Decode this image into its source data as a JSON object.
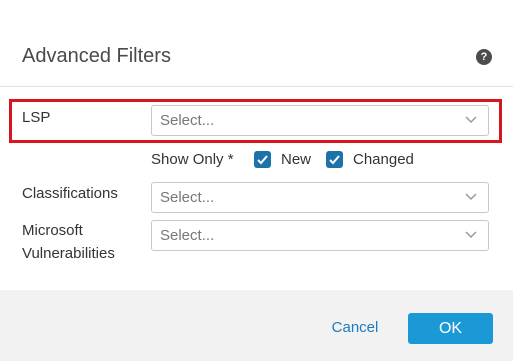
{
  "dialog": {
    "title": "Advanced Filters",
    "help_icon": "question-circle-icon",
    "help_glyph": "?"
  },
  "fields": {
    "lsp": {
      "label": "LSP",
      "placeholder": "Select..."
    },
    "show_only": {
      "label": "Show Only *",
      "options": [
        {
          "label": "New",
          "checked": true
        },
        {
          "label": "Changed",
          "checked": true
        }
      ]
    },
    "classifications": {
      "label": "Classifications",
      "placeholder": "Select..."
    },
    "microsoft_vulnerabilities": {
      "label_line1": "Microsoft",
      "label_line2": "Vulnerabilities",
      "placeholder": "Select..."
    }
  },
  "footer": {
    "cancel_label": "Cancel",
    "ok_label": "OK"
  },
  "colors": {
    "accent": "#1b99d7",
    "checkbox": "#1c72a9",
    "link": "#1c7bbf",
    "highlight_border": "#d9151f"
  }
}
